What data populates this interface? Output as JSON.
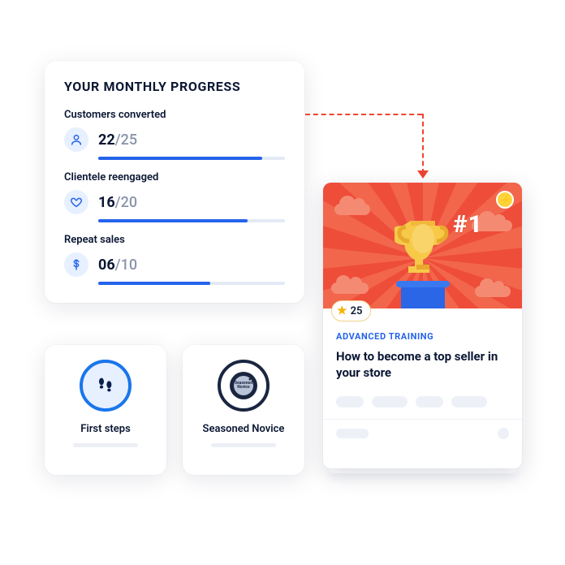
{
  "progress": {
    "heading": "YOUR MONTHLY PROGRESS",
    "metrics": [
      {
        "label": "Customers converted",
        "value": "22",
        "total": "/25",
        "pct": 88
      },
      {
        "label": "Clientele reengaged",
        "value": "16",
        "total": "/20",
        "pct": 80
      },
      {
        "label": "Repeat sales",
        "value": "06",
        "total": "/10",
        "pct": 60
      }
    ]
  },
  "badges": [
    {
      "title": "First steps"
    },
    {
      "title": "Seasoned Novice"
    }
  ],
  "training": {
    "points": "25",
    "category": "ADVANCED TRAINING",
    "title": "How to become a top seller in your store",
    "hero_tag": "#1"
  },
  "colors": {
    "accent": "#2563eb",
    "hero": "#ee4d3a",
    "arrow": "#ee4433"
  }
}
